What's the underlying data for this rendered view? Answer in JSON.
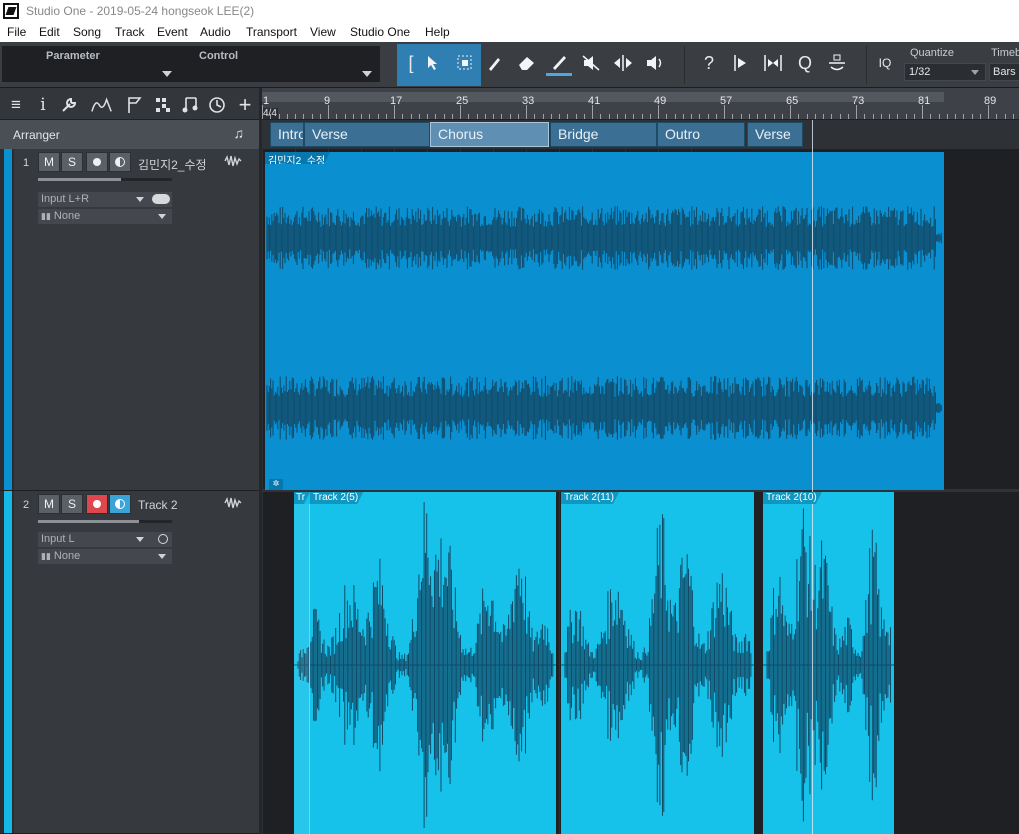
{
  "window": {
    "title": "Studio One - 2019-05-24 hongseok LEE(2)"
  },
  "menu": [
    "File",
    "Edit",
    "Song",
    "Track",
    "Event",
    "Audio",
    "Transport",
    "View",
    "Studio One",
    "Help"
  ],
  "toolbar": {
    "parameter_label": "Parameter",
    "control_label": "Control",
    "help_glyph": "?",
    "q_glyph": "Q",
    "iq_label": "IQ",
    "quantize_label": "Quantize",
    "quantize_value": "1/32",
    "timebase_label": "Timebase",
    "timebase_value": "Bars"
  },
  "arranger": {
    "label": "Arranger"
  },
  "ruler": {
    "time_signature": "4/4",
    "bars": [
      "1",
      "9",
      "17",
      "25",
      "33",
      "41",
      "49",
      "57",
      "65",
      "73",
      "81",
      "89"
    ]
  },
  "sections": [
    {
      "label": "Intro"
    },
    {
      "label": "Verse"
    },
    {
      "label": "Chorus"
    },
    {
      "label": "Bridge"
    },
    {
      "label": "Outro"
    },
    {
      "label": "Verse"
    }
  ],
  "tracks": [
    {
      "number": "1",
      "name": "김민지2_수정",
      "mute": "M",
      "solo": "S",
      "input": "Input L+R",
      "output": "None",
      "volume_fraction": 0.62,
      "record_armed": false,
      "monitor_on": false,
      "color": "#0a8fd0"
    },
    {
      "number": "2",
      "name": "Track 2",
      "mute": "M",
      "solo": "S",
      "input": "Input L",
      "output": "None",
      "volume_fraction": 0.75,
      "record_armed": true,
      "monitor_on": true,
      "color": "#16b8e6"
    }
  ],
  "events": [
    {
      "title": "김민지2_수정"
    },
    {
      "title": "Tr"
    },
    {
      "title": "Track 2(5)"
    },
    {
      "title": "Track 2(11)"
    },
    {
      "title": "Track 2(10)"
    }
  ],
  "colors": {
    "track1_event": "#0a8fd0",
    "track2_event": "#16c2ea",
    "wave_dark": "#124a68",
    "accent": "#2f7fb3"
  }
}
